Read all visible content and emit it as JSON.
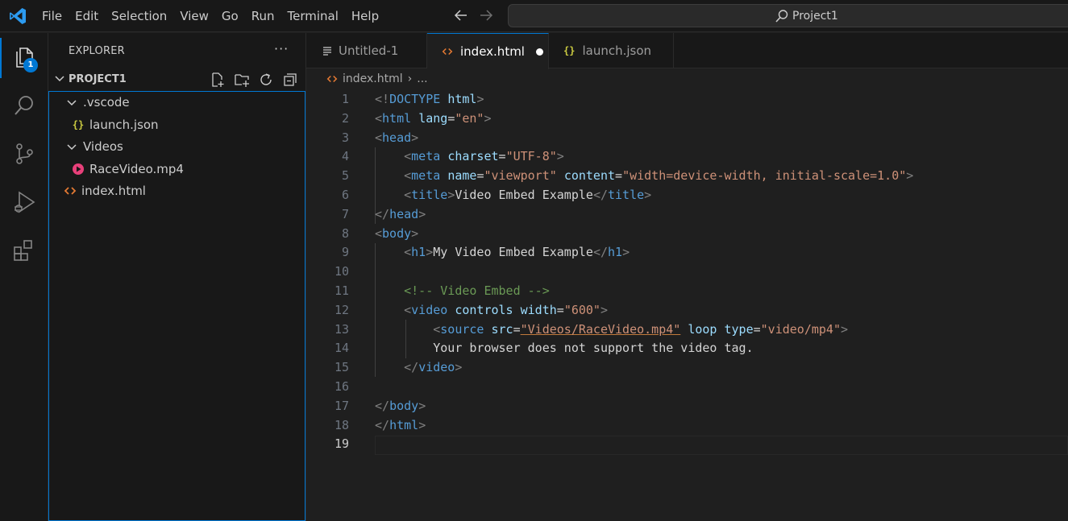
{
  "menu": [
    "File",
    "Edit",
    "Selection",
    "View",
    "Go",
    "Run",
    "Terminal",
    "Help"
  ],
  "search": {
    "text": "Project1"
  },
  "activity": {
    "badge": "1"
  },
  "explorer": {
    "title": "EXPLORER",
    "more": "···",
    "project": "PROJECT1",
    "tree": [
      {
        "label": ".vscode",
        "type": "folder"
      },
      {
        "label": "launch.json",
        "type": "json"
      },
      {
        "label": "Videos",
        "type": "folder"
      },
      {
        "label": "RaceVideo.mp4",
        "type": "video"
      },
      {
        "label": "index.html",
        "type": "html"
      }
    ]
  },
  "tabs": [
    {
      "label": "Untitled-1",
      "icon": "text-file-icon"
    },
    {
      "label": "index.html",
      "icon": "html-icon",
      "active": true,
      "modified": true
    },
    {
      "label": "launch.json",
      "icon": "json-icon"
    }
  ],
  "breadcrumb": {
    "file": "index.html",
    "separator": "›",
    "rest": "..."
  },
  "editor": {
    "current_line": 19,
    "lines": [
      [
        [
          "<!",
          "b"
        ],
        [
          "DOCTYPE",
          "tag"
        ],
        [
          " ",
          "txt"
        ],
        [
          "html",
          "attr"
        ],
        [
          ">",
          "b"
        ]
      ],
      [
        [
          "<",
          "b"
        ],
        [
          "html",
          "tag"
        ],
        [
          " ",
          "txt"
        ],
        [
          "lang",
          "attr"
        ],
        [
          "=",
          "txt"
        ],
        [
          "\"en\"",
          "str"
        ],
        [
          ">",
          "b"
        ]
      ],
      [
        [
          "<",
          "b"
        ],
        [
          "head",
          "tag"
        ],
        [
          ">",
          "b"
        ]
      ],
      [
        [
          "    ",
          "txt"
        ],
        [
          "<",
          "b"
        ],
        [
          "meta",
          "tag"
        ],
        [
          " ",
          "txt"
        ],
        [
          "charset",
          "attr"
        ],
        [
          "=",
          "txt"
        ],
        [
          "\"UTF-8\"",
          "str"
        ],
        [
          ">",
          "b"
        ]
      ],
      [
        [
          "    ",
          "txt"
        ],
        [
          "<",
          "b"
        ],
        [
          "meta",
          "tag"
        ],
        [
          " ",
          "txt"
        ],
        [
          "name",
          "attr"
        ],
        [
          "=",
          "txt"
        ],
        [
          "\"viewport\"",
          "str"
        ],
        [
          " ",
          "txt"
        ],
        [
          "content",
          "attr"
        ],
        [
          "=",
          "txt"
        ],
        [
          "\"width=device-width, initial-scale=1.0\"",
          "str"
        ],
        [
          ">",
          "b"
        ]
      ],
      [
        [
          "    ",
          "txt"
        ],
        [
          "<",
          "b"
        ],
        [
          "title",
          "tag"
        ],
        [
          ">",
          "b"
        ],
        [
          "Video Embed Example",
          "txt"
        ],
        [
          "</",
          "b"
        ],
        [
          "title",
          "tag"
        ],
        [
          ">",
          "b"
        ]
      ],
      [
        [
          "</",
          "b"
        ],
        [
          "head",
          "tag"
        ],
        [
          ">",
          "b"
        ]
      ],
      [
        [
          "<",
          "b"
        ],
        [
          "body",
          "tag"
        ],
        [
          ">",
          "b"
        ]
      ],
      [
        [
          "    ",
          "txt"
        ],
        [
          "<",
          "b"
        ],
        [
          "h1",
          "tag"
        ],
        [
          ">",
          "b"
        ],
        [
          "My Video Embed Example",
          "txt"
        ],
        [
          "</",
          "b"
        ],
        [
          "h1",
          "tag"
        ],
        [
          ">",
          "b"
        ]
      ],
      [
        [
          "",
          "txt"
        ]
      ],
      [
        [
          "    ",
          "txt"
        ],
        [
          "<!-- Video Embed -->",
          "cm"
        ]
      ],
      [
        [
          "    ",
          "txt"
        ],
        [
          "<",
          "b"
        ],
        [
          "video",
          "tag"
        ],
        [
          " ",
          "txt"
        ],
        [
          "controls",
          "attr"
        ],
        [
          " ",
          "txt"
        ],
        [
          "width",
          "attr"
        ],
        [
          "=",
          "txt"
        ],
        [
          "\"600\"",
          "str"
        ],
        [
          ">",
          "b"
        ]
      ],
      [
        [
          "        ",
          "txt"
        ],
        [
          "<",
          "b"
        ],
        [
          "source",
          "tag"
        ],
        [
          " ",
          "txt"
        ],
        [
          "src",
          "attr"
        ],
        [
          "=",
          "txt"
        ],
        [
          "\"Videos/RaceVideo.mp4\"",
          "str-u"
        ],
        [
          " ",
          "txt"
        ],
        [
          "loop",
          "attr"
        ],
        [
          " ",
          "txt"
        ],
        [
          "type",
          "attr"
        ],
        [
          "=",
          "txt"
        ],
        [
          "\"video/mp4\"",
          "str"
        ],
        [
          ">",
          "b"
        ]
      ],
      [
        [
          "        ",
          "txt"
        ],
        [
          "Your browser does not support the video tag.",
          "txt"
        ]
      ],
      [
        [
          "    ",
          "txt"
        ],
        [
          "</",
          "b"
        ],
        [
          "video",
          "tag"
        ],
        [
          ">",
          "b"
        ]
      ],
      [
        [
          "",
          "txt"
        ]
      ],
      [
        [
          "</",
          "b"
        ],
        [
          "body",
          "tag"
        ],
        [
          ">",
          "b"
        ]
      ],
      [
        [
          "</",
          "b"
        ],
        [
          "html",
          "tag"
        ],
        [
          ">",
          "b"
        ]
      ],
      [
        [
          "",
          "txt"
        ]
      ]
    ]
  },
  "colors": {
    "accent": "#0078d4",
    "video_icon": "#e8407a",
    "html_icon": "#e37933",
    "json_icon": "#cbcb41"
  }
}
